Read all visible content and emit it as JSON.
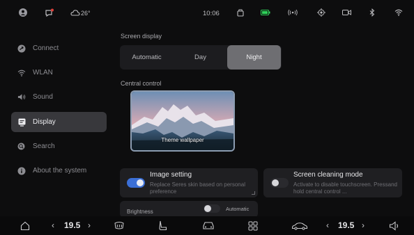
{
  "statusbar": {
    "temperature": "26°",
    "time": "10:06"
  },
  "sidebar": {
    "items": [
      {
        "label": "Connect",
        "icon": "connect-icon",
        "active": false
      },
      {
        "label": "WLAN",
        "icon": "wifi-icon",
        "active": false
      },
      {
        "label": "Sound",
        "icon": "speaker-icon",
        "active": false
      },
      {
        "label": "Display",
        "icon": "display-icon",
        "active": true
      },
      {
        "label": "Search",
        "icon": "search-icon",
        "active": false
      },
      {
        "label": "About the system",
        "icon": "info-icon",
        "active": false
      }
    ]
  },
  "main": {
    "screen_display": {
      "label": "Screen display",
      "options": [
        "Automatic",
        "Day",
        "Night"
      ],
      "selected": "Night"
    },
    "central_control": {
      "label": "Central control",
      "wallpaper_label": "Theme wallpaper"
    },
    "image_setting": {
      "title": "Image setting",
      "description": "Replace Seres skin based on personal preference",
      "enabled": true
    },
    "screen_cleaning": {
      "title": "Screen cleaning mode",
      "description": "Activate to disable touchscreen. Pressand hold central control ...",
      "enabled": false
    },
    "brightness": {
      "label": "Brightness",
      "auto_label": "Automatic",
      "auto_enabled": false
    }
  },
  "bottombar": {
    "left_temp": "19.5",
    "right_temp": "19.5"
  },
  "colors": {
    "accent": "#3b6fd6",
    "active_item": "#38383c",
    "background": "#0d0d0e"
  }
}
